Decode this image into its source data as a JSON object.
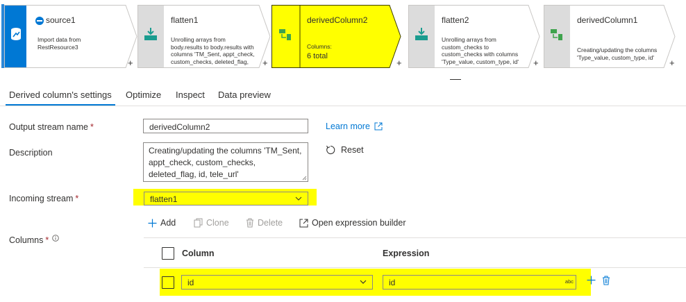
{
  "pipeline": {
    "nodes": [
      {
        "title": "source1",
        "desc": "Import data from RestResource3"
      },
      {
        "title": "flatten1",
        "desc": "Unrolling arrays from body.results to body.results with columns 'TM_Sent, appt_check, custom_checks, deleted_flag, id'"
      },
      {
        "title": "derivedColumn2",
        "desc_label": "Columns:",
        "desc_value": "6 total"
      },
      {
        "title": "flatten2",
        "desc": "Unrolling arrays from custom_checks to custom_checks with columns 'Type_value, custom_type, id'"
      },
      {
        "title": "derivedColumn1",
        "desc": "Creating/updating the columns 'Type_value, custom_type, id'"
      }
    ],
    "add_symbol": "+"
  },
  "tabs": [
    {
      "label": "Derived column's settings"
    },
    {
      "label": "Optimize"
    },
    {
      "label": "Inspect"
    },
    {
      "label": "Data preview"
    }
  ],
  "form": {
    "output_stream_label": "Output stream name",
    "output_stream_value": "derivedColumn2",
    "required_mark": "*",
    "learn_more": "Learn more",
    "description_label": "Description",
    "description_value": "Creating/updating the columns 'TM_Sent, appt_check, custom_checks, deleted_flag, id, tele_url'",
    "reset_label": "Reset",
    "incoming_stream_label": "Incoming stream",
    "incoming_stream_value": "flatten1",
    "columns_label": "Columns"
  },
  "toolbar": {
    "add": "Add",
    "clone": "Clone",
    "delete": "Delete",
    "open_builder": "Open expression builder"
  },
  "grid": {
    "column_header": "Column",
    "expression_header": "Expression",
    "rows": [
      {
        "column": "id",
        "expression": "id",
        "type_badge": "abc"
      }
    ]
  },
  "colors": {
    "accent": "#0078d4",
    "highlight": "#ffff00",
    "source_strip": "#0078d4",
    "transform_strip": "#dcdcdc"
  }
}
